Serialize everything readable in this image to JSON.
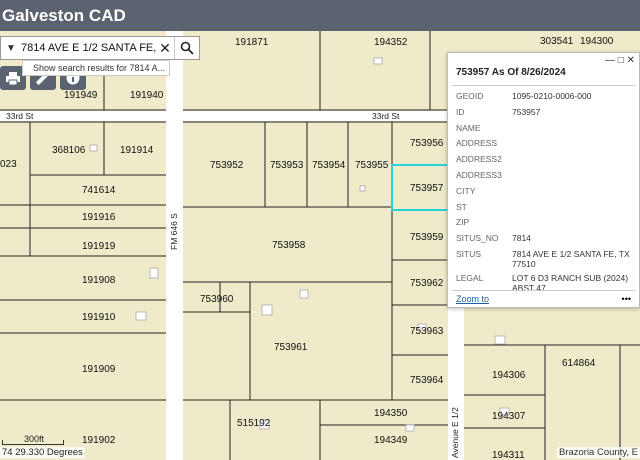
{
  "app": {
    "title": "Galveston CAD"
  },
  "search": {
    "value": "7814 AVE E 1/2 SANTA FE,",
    "hint": "Show search results for 7814 A..."
  },
  "icons": {
    "dropdown": "chevron-down-icon",
    "clear": "close-icon",
    "search": "search-icon",
    "print": "printer-icon",
    "measure": "ruler-icon",
    "info": "info-icon"
  },
  "colors": {
    "header": "#5b6370",
    "map_bg": "#efeac9",
    "road": "#ffffff",
    "selected": "#27d3d8",
    "parcel_line": "#222222"
  },
  "roads": {
    "street_33rd": "33rd St",
    "fm646": "FM 646 S",
    "ave_e_half": "Avenue E 1/2"
  },
  "parcels": {
    "p191871": "191871",
    "p194352": "194352",
    "p303541": "303541",
    "p194300": "194300",
    "p191940": "191940",
    "p191949": "191949",
    "p368106": "368106",
    "p191914": "191914",
    "p023": "023",
    "p741614": "741614",
    "p191916": "191916",
    "p191919": "191919",
    "p191908": "191908",
    "p191910": "191910",
    "p191909": "191909",
    "p191902": "191902",
    "p753952": "753952",
    "p753953": "753953",
    "p753954": "753954",
    "p753955": "753955",
    "p753956": "753956",
    "p753957": "753957",
    "p753958": "753958",
    "p753959": "753959",
    "p753960": "753960",
    "p753961": "753961",
    "p753962": "753962",
    "p753963": "753963",
    "p753964": "753964",
    "p515192": "515192",
    "p194350": "194350",
    "p194349": "194349",
    "p614864": "614864",
    "p194306": "194306",
    "p194307": "194307",
    "p194311": "194311"
  },
  "popup": {
    "title": "753957 As Of 8/26/2024",
    "controls": "— □ ✕",
    "rows": [
      {
        "key": "GEOID",
        "value": "1095-0210-0006-000"
      },
      {
        "key": "ID",
        "value": "753957"
      },
      {
        "key": "NAME",
        "value": ""
      },
      {
        "key": "ADDRESS",
        "value": ""
      },
      {
        "key": "ADDRESS2",
        "value": ""
      },
      {
        "key": "ADDRESS3",
        "value": ""
      },
      {
        "key": "CITY",
        "value": ""
      },
      {
        "key": "ST",
        "value": ""
      },
      {
        "key": "ZIP",
        "value": ""
      },
      {
        "key": "SITUS_NO",
        "value": "7814"
      },
      {
        "key": "SITUS",
        "value": "7814 AVE E 1/2 SANTA FE, TX 77510"
      },
      {
        "key": "LEGAL",
        "value": "LOT 6 D3 RANCH SUB (2024) ABST 47"
      }
    ],
    "zoom_label": "Zoom to",
    "more_label": "•••"
  },
  "status": {
    "coords": "74 29.330 Degrees",
    "scale": "300ft",
    "attribution": "Brazoria County, E"
  }
}
